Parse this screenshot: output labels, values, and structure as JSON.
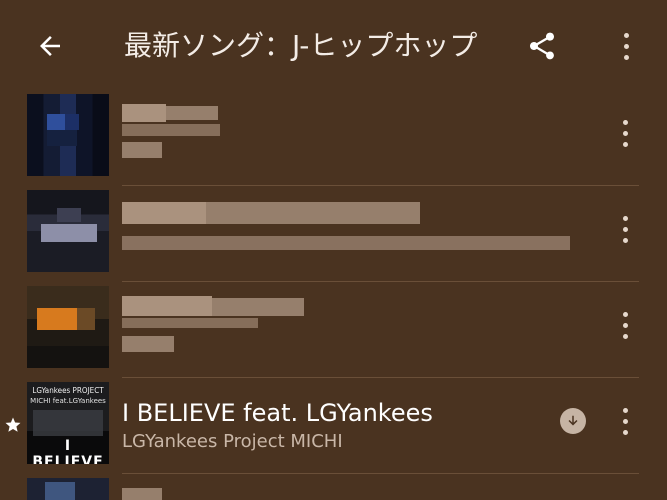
{
  "header": {
    "title": "最新ソング：J-ヒップホップ",
    "back_icon": "arrow-back-icon",
    "share_icon": "share-icon",
    "menu_icon": "more-vert-icon"
  },
  "songs": [
    {
      "title": "",
      "artist": "",
      "blurred": true
    },
    {
      "title": "",
      "artist": "",
      "blurred": true
    },
    {
      "title": "",
      "artist": "",
      "blurred": true
    },
    {
      "title": "I BELIEVE feat. LGYankees",
      "artist": "LGYankees Project MICHI",
      "favorite_icon": "star-icon",
      "download_icon": "download-icon",
      "cover": {
        "line1": "LGYankees PROJECT",
        "line2": "MICHI feat.LGYankees",
        "big": "I BELIEVE"
      }
    }
  ],
  "colors": {
    "background": "#4a3320",
    "divider": "#6a4f38",
    "artist_text": "#c9b7a8"
  }
}
